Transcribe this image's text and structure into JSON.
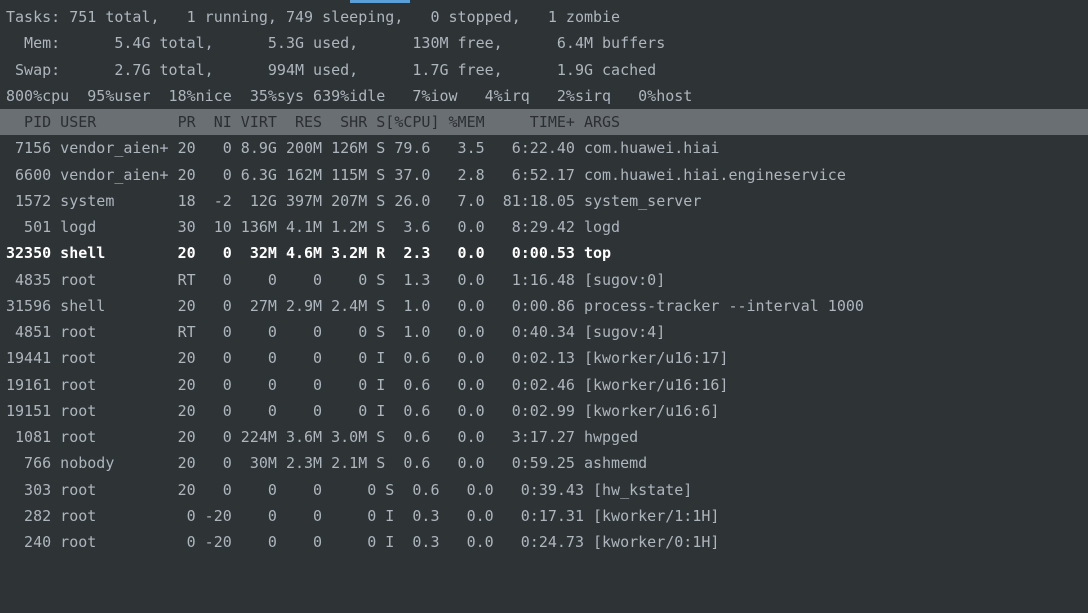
{
  "summary": {
    "tasks_line": "Tasks: 751 total,   1 running, 749 sleeping,   0 stopped,   1 zombie",
    "mem_line": "  Mem:      5.4G total,      5.3G used,      130M free,      6.4M buffers",
    "swap_line": " Swap:      2.7G total,      994M used,      1.7G free,      1.9G cached",
    "cpu_line": "800%cpu  95%user  18%nice  35%sys 639%idle   7%iow   4%irq   2%sirq   0%host"
  },
  "header": "  PID USER         PR  NI VIRT  RES  SHR S[%CPU] %MEM     TIME+ ARGS                              ",
  "processes": [
    {
      "pid": "7156",
      "user": "vendor_aien+",
      "pr": "20",
      "ni": "0",
      "virt": "8.9G",
      "res": "200M",
      "shr": "126M",
      "s": "S",
      "cpu": "79.6",
      "mem": "3.5",
      "time": "6:22.40",
      "args": "com.huawei.hiai",
      "hl": false
    },
    {
      "pid": "6600",
      "user": "vendor_aien+",
      "pr": "20",
      "ni": "0",
      "virt": "6.3G",
      "res": "162M",
      "shr": "115M",
      "s": "S",
      "cpu": "37.0",
      "mem": "2.8",
      "time": "6:52.17",
      "args": "com.huawei.hiai.engineservice",
      "hl": false
    },
    {
      "pid": "1572",
      "user": "system",
      "pr": "18",
      "ni": "-2",
      "virt": "12G",
      "res": "397M",
      "shr": "207M",
      "s": "S",
      "cpu": "26.0",
      "mem": "7.0",
      "time": "81:18.05",
      "args": "system_server",
      "hl": false
    },
    {
      "pid": "501",
      "user": "logd",
      "pr": "30",
      "ni": "10",
      "virt": "136M",
      "res": "4.1M",
      "shr": "1.2M",
      "s": "S",
      "cpu": "3.6",
      "mem": "0.0",
      "time": "8:29.42",
      "args": "logd",
      "hl": false
    },
    {
      "pid": "32350",
      "user": "shell",
      "pr": "20",
      "ni": "0",
      "virt": "32M",
      "res": "4.6M",
      "shr": "3.2M",
      "s": "R",
      "cpu": "2.3",
      "mem": "0.0",
      "time": "0:00.53",
      "args": "top",
      "hl": true
    },
    {
      "pid": "4835",
      "user": "root",
      "pr": "RT",
      "ni": "0",
      "virt": "0",
      "res": "0",
      "shr": "0",
      "s": "S",
      "cpu": "1.3",
      "mem": "0.0",
      "time": "1:16.48",
      "args": "[sugov:0]",
      "hl": false
    },
    {
      "pid": "31596",
      "user": "shell",
      "pr": "20",
      "ni": "0",
      "virt": "27M",
      "res": "2.9M",
      "shr": "2.4M",
      "s": "S",
      "cpu": "1.0",
      "mem": "0.0",
      "time": "0:00.86",
      "args": "process-tracker --interval 1000",
      "hl": false
    },
    {
      "pid": "4851",
      "user": "root",
      "pr": "RT",
      "ni": "0",
      "virt": "0",
      "res": "0",
      "shr": "0",
      "s": "S",
      "cpu": "1.0",
      "mem": "0.0",
      "time": "0:40.34",
      "args": "[sugov:4]",
      "hl": false
    },
    {
      "pid": "19441",
      "user": "root",
      "pr": "20",
      "ni": "0",
      "virt": "0",
      "res": "0",
      "shr": "0",
      "s": "I",
      "cpu": "0.6",
      "mem": "0.0",
      "time": "0:02.13",
      "args": "[kworker/u16:17]",
      "hl": false
    },
    {
      "pid": "19161",
      "user": "root",
      "pr": "20",
      "ni": "0",
      "virt": "0",
      "res": "0",
      "shr": "0",
      "s": "I",
      "cpu": "0.6",
      "mem": "0.0",
      "time": "0:02.46",
      "args": "[kworker/u16:16]",
      "hl": false
    },
    {
      "pid": "19151",
      "user": "root",
      "pr": "20",
      "ni": "0",
      "virt": "0",
      "res": "0",
      "shr": "0",
      "s": "I",
      "cpu": "0.6",
      "mem": "0.0",
      "time": "0:02.99",
      "args": "[kworker/u16:6]",
      "hl": false
    },
    {
      "pid": "1081",
      "user": "root",
      "pr": "20",
      "ni": "0",
      "virt": "224M",
      "res": "3.6M",
      "shr": "3.0M",
      "s": "S",
      "cpu": "0.6",
      "mem": "0.0",
      "time": "3:17.27",
      "args": "hwpged",
      "hl": false
    },
    {
      "pid": "766",
      "user": "nobody",
      "pr": "20",
      "ni": "0",
      "virt": "30M",
      "res": "2.3M",
      "shr": "2.1M",
      "s": "S",
      "cpu": "0.6",
      "mem": "0.0",
      "time": "0:59.25",
      "args": "ashmemd",
      "hl": false
    },
    {
      "pid": "303",
      "user": "root",
      "pr": "20",
      "ni": "0",
      "virt": "0",
      "res": "0",
      "shr": "",
      "s": "0 S",
      "cpu": "0.6",
      "mem": "0.0",
      "time": "0:39.43",
      "args": "[hw_kstate]",
      "hl": false
    },
    {
      "pid": "282",
      "user": "root",
      "pr": "0",
      "ni": "-20",
      "virt": "0",
      "res": "0",
      "shr": "",
      "s": "0 I",
      "cpu": "0.3",
      "mem": "0.0",
      "time": "0:17.31",
      "args": "[kworker/1:1H]",
      "hl": false
    },
    {
      "pid": "240",
      "user": "root",
      "pr": "0",
      "ni": "-20",
      "virt": "0",
      "res": "0",
      "shr": "",
      "s": "0 I",
      "cpu": "0.3",
      "mem": "0.0",
      "time": "0:24.73",
      "args": "[kworker/0:1H]",
      "hl": false
    }
  ],
  "columns": {
    "pid_w": 5,
    "user_w": 12,
    "pr_w": 3,
    "ni_w": 3,
    "virt_w": 4,
    "res_w": 4,
    "shr_w": 4,
    "s_w": 1,
    "cpu_w": 5,
    "mem_w": 4,
    "time_w": 9
  }
}
